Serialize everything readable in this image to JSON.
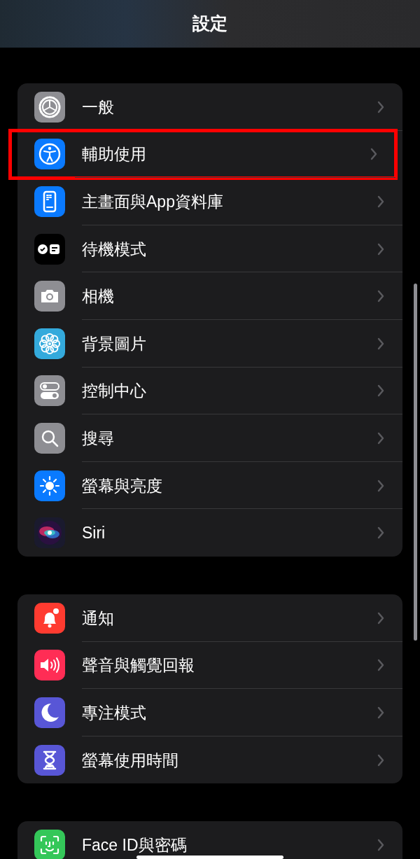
{
  "title": "設定",
  "groups": [
    {
      "items": [
        {
          "label": "一般",
          "color": "#8e8e93",
          "highlighted": false
        },
        {
          "label": "輔助使用",
          "color": "#0a7aff",
          "highlighted": true
        },
        {
          "label": "主畫面與App資料庫",
          "color": "#0a7aff",
          "highlighted": false
        },
        {
          "label": "待機模式",
          "color": "#000000",
          "highlighted": false
        },
        {
          "label": "相機",
          "color": "#8e8e93",
          "highlighted": false
        },
        {
          "label": "背景圖片",
          "color": "#34aadc",
          "highlighted": false
        },
        {
          "label": "控制中心",
          "color": "#8e8e93",
          "highlighted": false
        },
        {
          "label": "搜尋",
          "color": "#8e8e93",
          "highlighted": false
        },
        {
          "label": "螢幕與亮度",
          "color": "#0a7aff",
          "highlighted": false
        },
        {
          "label": "Siri",
          "color": "#1a1a2e",
          "highlighted": false
        }
      ]
    },
    {
      "items": [
        {
          "label": "通知",
          "color": "#ff3b30",
          "highlighted": false
        },
        {
          "label": "聲音與觸覺回報",
          "color": "#ff2d55",
          "highlighted": false
        },
        {
          "label": "專注模式",
          "color": "#5856d6",
          "highlighted": false
        },
        {
          "label": "螢幕使用時間",
          "color": "#5856d6",
          "highlighted": false
        }
      ]
    },
    {
      "items": [
        {
          "label": "Face ID與密碼",
          "color": "#34c759",
          "highlighted": false
        }
      ]
    }
  ]
}
